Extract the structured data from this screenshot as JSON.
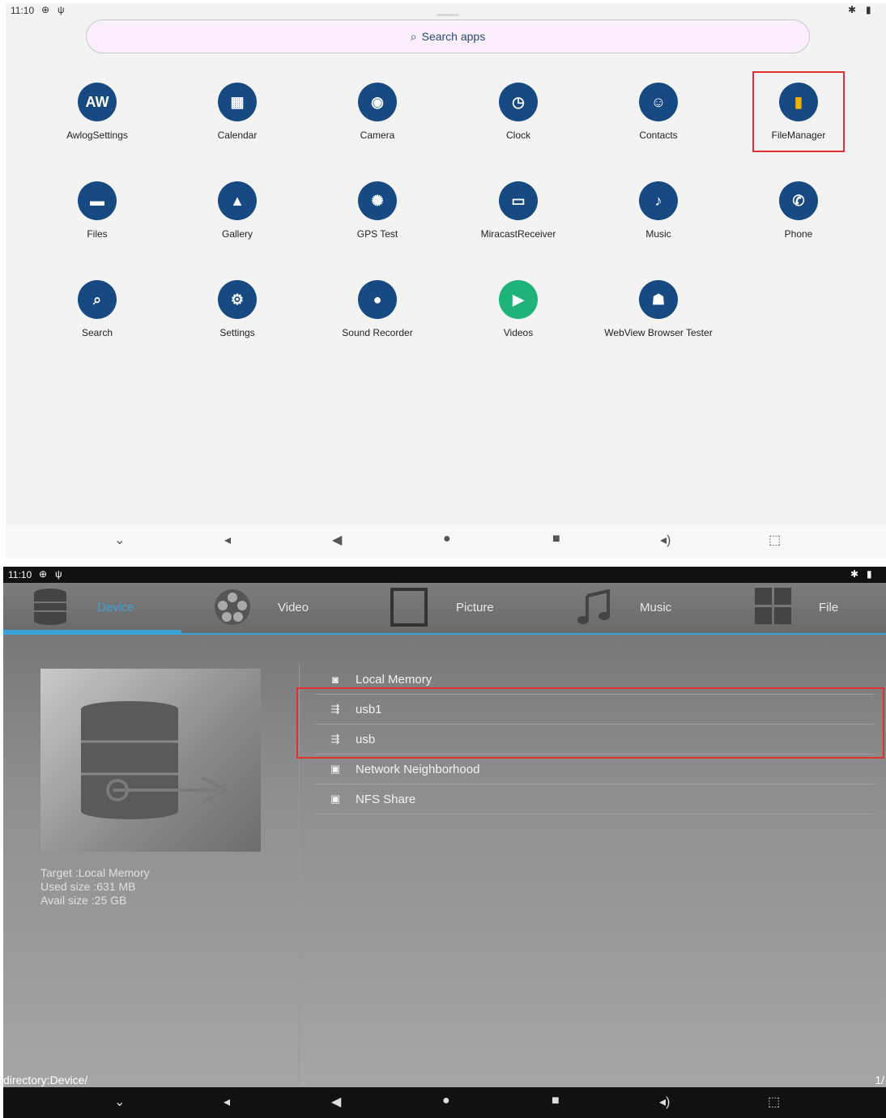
{
  "launcher": {
    "status": {
      "time": "11:10"
    },
    "search_placeholder": "Search apps",
    "apps": [
      {
        "label": "AwlogSettings",
        "icon": "awlog-icon",
        "glyph": "AW"
      },
      {
        "label": "Calendar",
        "icon": "calendar-icon",
        "glyph": "▦"
      },
      {
        "label": "Camera",
        "icon": "camera-icon",
        "glyph": "◉"
      },
      {
        "label": "Clock",
        "icon": "clock-icon",
        "glyph": "◷"
      },
      {
        "label": "Contacts",
        "icon": "contacts-icon",
        "glyph": "☺"
      },
      {
        "label": "FileManager",
        "icon": "file-manager-icon",
        "glyph": "▮"
      },
      {
        "label": "Files",
        "icon": "files-icon",
        "glyph": "▬"
      },
      {
        "label": "Gallery",
        "icon": "gallery-icon",
        "glyph": "▲"
      },
      {
        "label": "GPS Test",
        "icon": "gps-icon",
        "glyph": "✺"
      },
      {
        "label": "MiracastReceiver",
        "icon": "miracast-icon",
        "glyph": "▭"
      },
      {
        "label": "Music",
        "icon": "music-icon",
        "glyph": "♪"
      },
      {
        "label": "Phone",
        "icon": "phone-icon",
        "glyph": "✆"
      },
      {
        "label": "Search",
        "icon": "search-app-icon",
        "glyph": "⌕"
      },
      {
        "label": "Settings",
        "icon": "settings-icon",
        "glyph": "⚙"
      },
      {
        "label": "Sound Recorder",
        "icon": "mic-icon",
        "glyph": "●"
      },
      {
        "label": "Videos",
        "icon": "videos-icon",
        "glyph": "▶"
      },
      {
        "label": "WebView Browser Tester",
        "icon": "android-icon",
        "glyph": "☗"
      }
    ]
  },
  "filemanager": {
    "status": {
      "time": "11:10"
    },
    "tabs": [
      "Device",
      "Video",
      "Picture",
      "Music",
      "File"
    ],
    "active_tab": "Device",
    "list": [
      {
        "label": "Local Memory",
        "icon": "memory-icon"
      },
      {
        "label": "usb1",
        "icon": "usb-icon"
      },
      {
        "label": "usb",
        "icon": "usb-icon"
      },
      {
        "label": "Network Neighborhood",
        "icon": "network-icon"
      },
      {
        "label": "NFS Share",
        "icon": "nfs-icon"
      }
    ],
    "info": {
      "target": "Target :Local Memory",
      "used": "Used size :631 MB",
      "avail": "Avail size :25 GB"
    },
    "directory": "directory:Device/",
    "page": "1/"
  },
  "colors": {
    "accent": "#3aa3d8",
    "highlight": "#e03030",
    "app_icon_bg": "#174a82"
  }
}
